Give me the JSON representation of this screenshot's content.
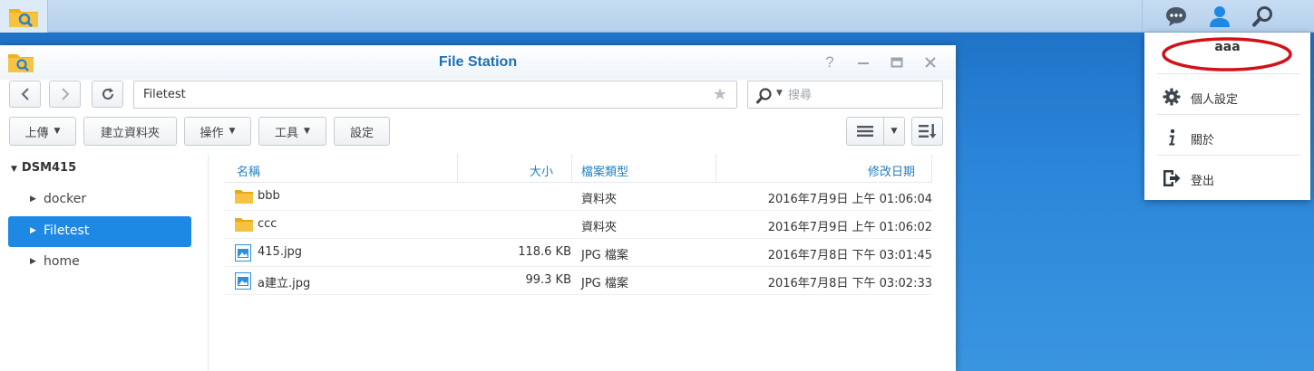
{
  "window": {
    "title": "File Station",
    "controls": [
      "help",
      "minimize",
      "maximize",
      "close"
    ]
  },
  "address": {
    "path": "Filetest",
    "search_placeholder": "搜尋"
  },
  "toolbar": {
    "upload": "上傳",
    "new_folder": "建立資料夾",
    "action": "操作",
    "tools": "工具",
    "settings": "設定"
  },
  "tree": {
    "root": "DSM415",
    "items": [
      {
        "label": "docker"
      },
      {
        "label": "Filetest"
      },
      {
        "label": "home"
      }
    ]
  },
  "table": {
    "headers": {
      "name": "名稱",
      "size": "大小",
      "type": "檔案類型",
      "modified": "修改日期"
    },
    "rows": [
      {
        "name": "bbb",
        "size": "",
        "type": "資料夾",
        "modified": "2016年7月9日 上午 01:06:04"
      },
      {
        "name": "ccc",
        "size": "",
        "type": "資料夾",
        "modified": "2016年7月9日 上午 01:06:02"
      },
      {
        "name": "415.jpg",
        "size": "118.6 KB",
        "type": "JPG 檔案",
        "modified": "2016年7月8日 下午 03:01:45"
      },
      {
        "name": "a建立.jpg",
        "size": "99.3 KB",
        "type": "JPG 檔案",
        "modified": "2016年7月8日 下午 03:02:33"
      }
    ]
  },
  "menu": {
    "username": "aaa",
    "items": [
      {
        "label": "個人設定",
        "icon": "gear-icon"
      },
      {
        "label": "關於",
        "icon": "info-icon"
      },
      {
        "label": "登出",
        "icon": "logout-icon"
      }
    ]
  },
  "colors": {
    "accent": "#1e88e5",
    "title": "#1f6fb5",
    "desktop": "#2b86d9",
    "highlight_ellipse": "#d0121b"
  }
}
